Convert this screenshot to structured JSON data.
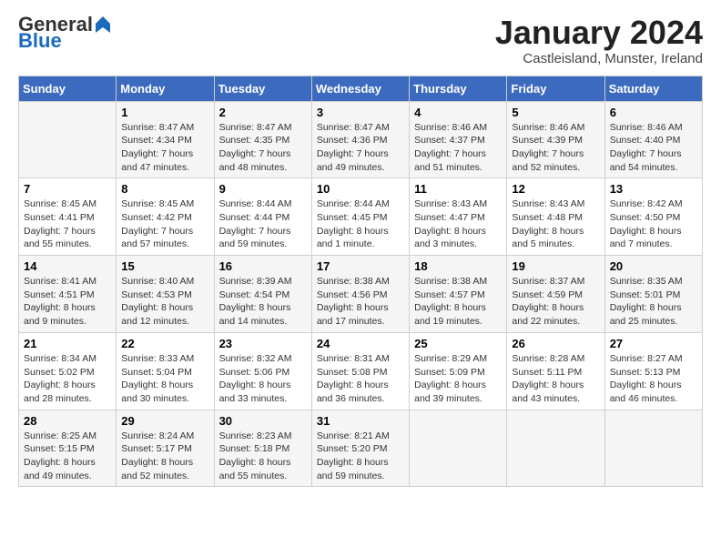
{
  "header": {
    "logo_general": "General",
    "logo_blue": "Blue",
    "month_title": "January 2024",
    "subtitle": "Castleisland, Munster, Ireland"
  },
  "weekdays": [
    "Sunday",
    "Monday",
    "Tuesday",
    "Wednesday",
    "Thursday",
    "Friday",
    "Saturday"
  ],
  "weeks": [
    [
      {
        "day": "",
        "detail": ""
      },
      {
        "day": "1",
        "detail": "Sunrise: 8:47 AM\nSunset: 4:34 PM\nDaylight: 7 hours\nand 47 minutes."
      },
      {
        "day": "2",
        "detail": "Sunrise: 8:47 AM\nSunset: 4:35 PM\nDaylight: 7 hours\nand 48 minutes."
      },
      {
        "day": "3",
        "detail": "Sunrise: 8:47 AM\nSunset: 4:36 PM\nDaylight: 7 hours\nand 49 minutes."
      },
      {
        "day": "4",
        "detail": "Sunrise: 8:46 AM\nSunset: 4:37 PM\nDaylight: 7 hours\nand 51 minutes."
      },
      {
        "day": "5",
        "detail": "Sunrise: 8:46 AM\nSunset: 4:39 PM\nDaylight: 7 hours\nand 52 minutes."
      },
      {
        "day": "6",
        "detail": "Sunrise: 8:46 AM\nSunset: 4:40 PM\nDaylight: 7 hours\nand 54 minutes."
      }
    ],
    [
      {
        "day": "7",
        "detail": "Sunrise: 8:45 AM\nSunset: 4:41 PM\nDaylight: 7 hours\nand 55 minutes."
      },
      {
        "day": "8",
        "detail": "Sunrise: 8:45 AM\nSunset: 4:42 PM\nDaylight: 7 hours\nand 57 minutes."
      },
      {
        "day": "9",
        "detail": "Sunrise: 8:44 AM\nSunset: 4:44 PM\nDaylight: 7 hours\nand 59 minutes."
      },
      {
        "day": "10",
        "detail": "Sunrise: 8:44 AM\nSunset: 4:45 PM\nDaylight: 8 hours\nand 1 minute."
      },
      {
        "day": "11",
        "detail": "Sunrise: 8:43 AM\nSunset: 4:47 PM\nDaylight: 8 hours\nand 3 minutes."
      },
      {
        "day": "12",
        "detail": "Sunrise: 8:43 AM\nSunset: 4:48 PM\nDaylight: 8 hours\nand 5 minutes."
      },
      {
        "day": "13",
        "detail": "Sunrise: 8:42 AM\nSunset: 4:50 PM\nDaylight: 8 hours\nand 7 minutes."
      }
    ],
    [
      {
        "day": "14",
        "detail": "Sunrise: 8:41 AM\nSunset: 4:51 PM\nDaylight: 8 hours\nand 9 minutes."
      },
      {
        "day": "15",
        "detail": "Sunrise: 8:40 AM\nSunset: 4:53 PM\nDaylight: 8 hours\nand 12 minutes."
      },
      {
        "day": "16",
        "detail": "Sunrise: 8:39 AM\nSunset: 4:54 PM\nDaylight: 8 hours\nand 14 minutes."
      },
      {
        "day": "17",
        "detail": "Sunrise: 8:38 AM\nSunset: 4:56 PM\nDaylight: 8 hours\nand 17 minutes."
      },
      {
        "day": "18",
        "detail": "Sunrise: 8:38 AM\nSunset: 4:57 PM\nDaylight: 8 hours\nand 19 minutes."
      },
      {
        "day": "19",
        "detail": "Sunrise: 8:37 AM\nSunset: 4:59 PM\nDaylight: 8 hours\nand 22 minutes."
      },
      {
        "day": "20",
        "detail": "Sunrise: 8:35 AM\nSunset: 5:01 PM\nDaylight: 8 hours\nand 25 minutes."
      }
    ],
    [
      {
        "day": "21",
        "detail": "Sunrise: 8:34 AM\nSunset: 5:02 PM\nDaylight: 8 hours\nand 28 minutes."
      },
      {
        "day": "22",
        "detail": "Sunrise: 8:33 AM\nSunset: 5:04 PM\nDaylight: 8 hours\nand 30 minutes."
      },
      {
        "day": "23",
        "detail": "Sunrise: 8:32 AM\nSunset: 5:06 PM\nDaylight: 8 hours\nand 33 minutes."
      },
      {
        "day": "24",
        "detail": "Sunrise: 8:31 AM\nSunset: 5:08 PM\nDaylight: 8 hours\nand 36 minutes."
      },
      {
        "day": "25",
        "detail": "Sunrise: 8:29 AM\nSunset: 5:09 PM\nDaylight: 8 hours\nand 39 minutes."
      },
      {
        "day": "26",
        "detail": "Sunrise: 8:28 AM\nSunset: 5:11 PM\nDaylight: 8 hours\nand 43 minutes."
      },
      {
        "day": "27",
        "detail": "Sunrise: 8:27 AM\nSunset: 5:13 PM\nDaylight: 8 hours\nand 46 minutes."
      }
    ],
    [
      {
        "day": "28",
        "detail": "Sunrise: 8:25 AM\nSunset: 5:15 PM\nDaylight: 8 hours\nand 49 minutes."
      },
      {
        "day": "29",
        "detail": "Sunrise: 8:24 AM\nSunset: 5:17 PM\nDaylight: 8 hours\nand 52 minutes."
      },
      {
        "day": "30",
        "detail": "Sunrise: 8:23 AM\nSunset: 5:18 PM\nDaylight: 8 hours\nand 55 minutes."
      },
      {
        "day": "31",
        "detail": "Sunrise: 8:21 AM\nSunset: 5:20 PM\nDaylight: 8 hours\nand 59 minutes."
      },
      {
        "day": "",
        "detail": ""
      },
      {
        "day": "",
        "detail": ""
      },
      {
        "day": "",
        "detail": ""
      }
    ]
  ]
}
